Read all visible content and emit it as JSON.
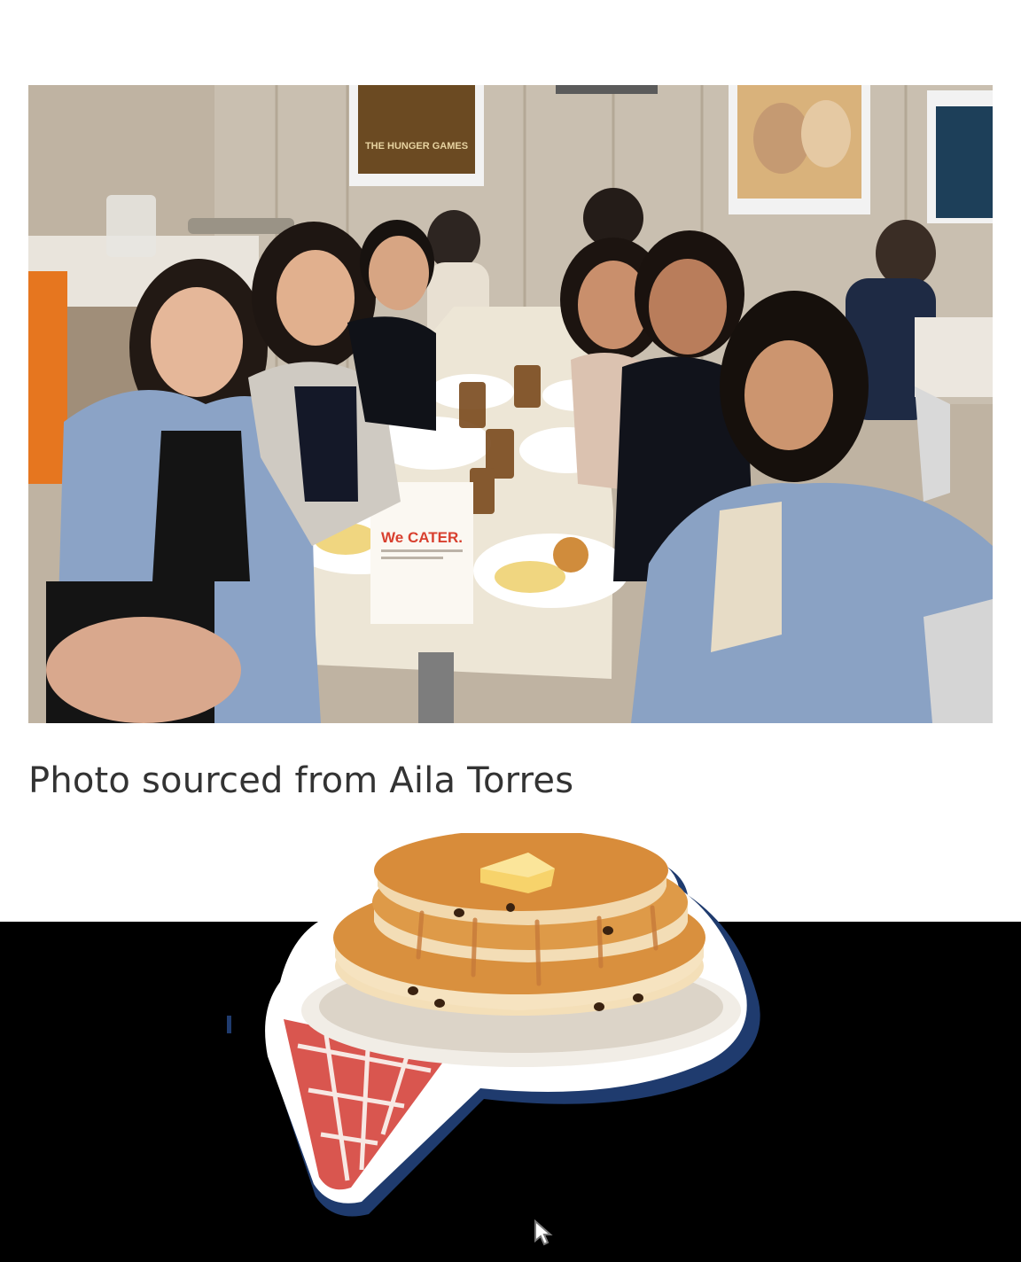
{
  "photo": {
    "alt": "Group photo of eight friends at a restaurant table",
    "poster_left_text": "THE HUNGER GAMES",
    "tent_card_headline": "We CATER.",
    "tent_card_subtext": "Make Pancake House part of your celebrations."
  },
  "caption": "Photo sourced from Aila Torres",
  "sticker": {
    "icon": "pancake-stack-icon"
  },
  "colors": {
    "background": "#ffffff",
    "band": "#000000",
    "caption_text": "#333333",
    "pancake": "#d9903e",
    "butter": "#f7d36b",
    "checker": "#d9564f",
    "outline_blue": "#1f3b6e"
  }
}
